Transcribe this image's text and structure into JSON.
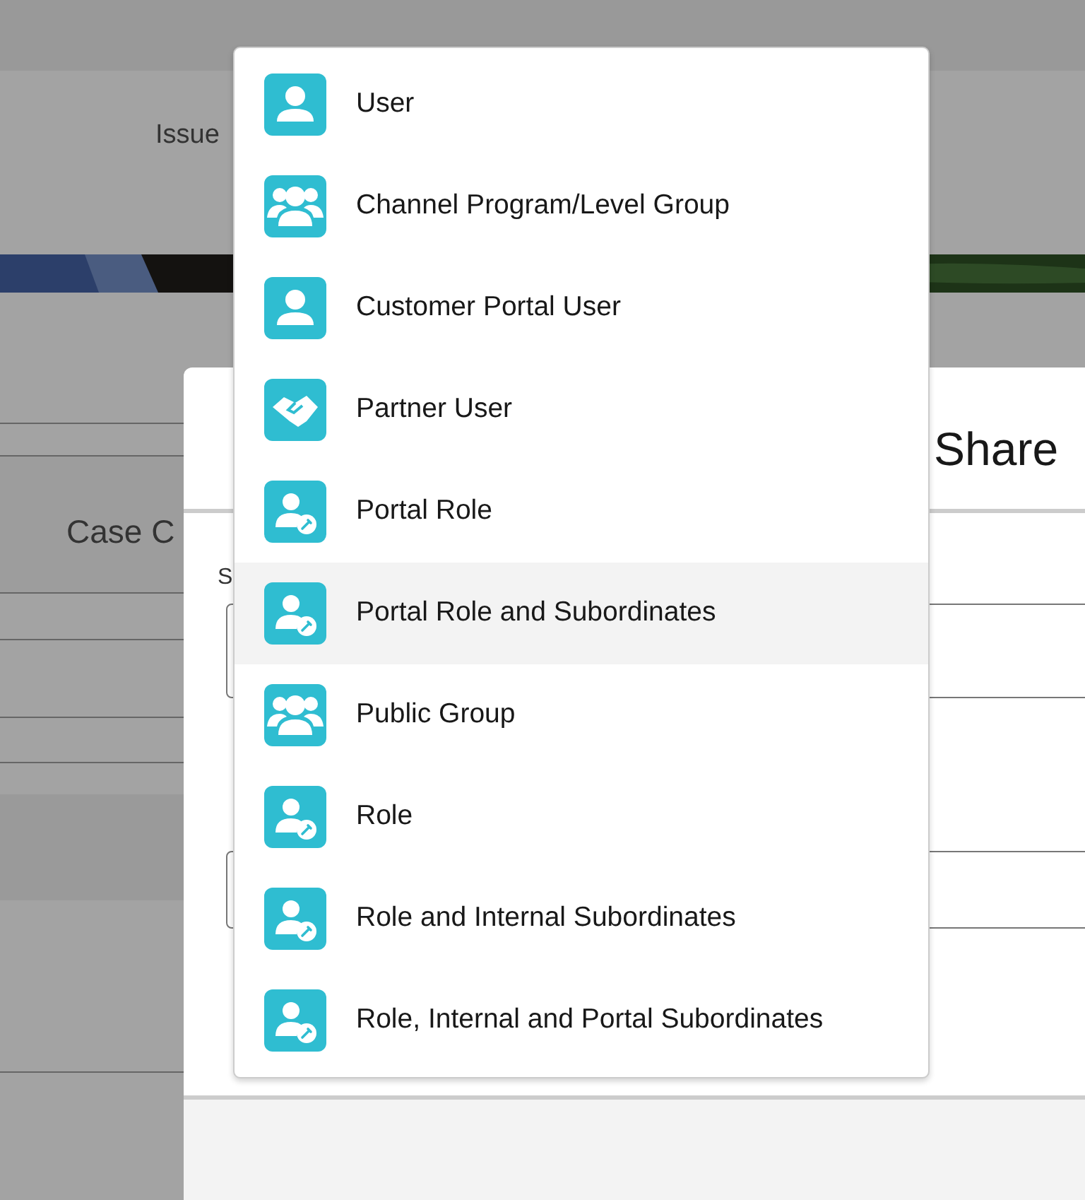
{
  "background": {
    "header_text": "Issue",
    "section_title": "Case C"
  },
  "modal": {
    "title": "Share",
    "field_label": "S"
  },
  "dropdown": {
    "items": [
      {
        "label": "User",
        "kind": "user",
        "selected": false
      },
      {
        "label": "Channel Program/Level Group",
        "kind": "group",
        "selected": false
      },
      {
        "label": "Customer Portal User",
        "kind": "user",
        "selected": false
      },
      {
        "label": "Partner User",
        "kind": "partner",
        "selected": false
      },
      {
        "label": "Portal Role",
        "kind": "role",
        "selected": false
      },
      {
        "label": "Portal Role and Subordinates",
        "kind": "role",
        "selected": true
      },
      {
        "label": "Public Group",
        "kind": "group",
        "selected": false
      },
      {
        "label": "Role",
        "kind": "role",
        "selected": false
      },
      {
        "label": "Role and Internal Subordinates",
        "kind": "role",
        "selected": false
      },
      {
        "label": "Role, Internal and Portal Subordinates",
        "kind": "role",
        "selected": false
      }
    ]
  }
}
